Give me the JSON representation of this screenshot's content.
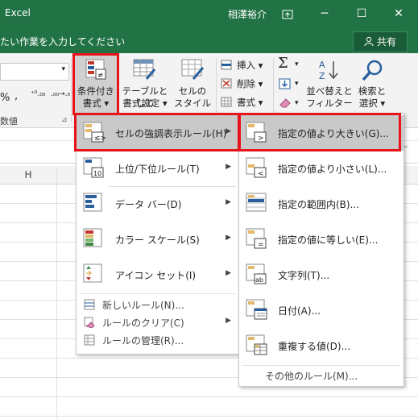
{
  "window": {
    "app_name": "Excel",
    "user_name": "相澤裕介",
    "minimize": "─",
    "maximize": "☐",
    "close": "✕",
    "restore_icon": "ribbon-display-icon"
  },
  "tellme": {
    "placeholder": "たい作業を入力してください",
    "share_label": "共有"
  },
  "ribbon": {
    "conditional_formatting": [
      "条件付き",
      "書式 ▾"
    ],
    "format_as_table": [
      "テーブルとして",
      "書式設定 ▾"
    ],
    "cell_styles": [
      "セルの",
      "スタイル ▾"
    ],
    "insert": "挿入 ▾",
    "delete": "削除 ▾",
    "format": "書式 ▾",
    "sum_arrow": "▾",
    "sort_filter": [
      "並べ替えと",
      "フィルター ▾"
    ],
    "find_select": [
      "検索と",
      "選択 ▾"
    ],
    "number_group_label": "数値",
    "percent": "%",
    "comma": ",",
    "inc_decimal": "⁺⁰.₀₀",
    "dec_decimal": ".₀₀→.₀",
    "number_format_dropdown": "▾"
  },
  "grid": {
    "column_h": "H"
  },
  "main_menu": {
    "items": [
      {
        "label": "セルの強調表示ルール(H)",
        "icon": "highlight-cells-icon",
        "arrow": "▶"
      },
      {
        "label": "上位/下位ルール(T)",
        "icon": "top-bottom-icon",
        "arrow": "▶"
      },
      {
        "label": "データ バー(D)",
        "icon": "data-bar-icon",
        "arrow": "▶"
      },
      {
        "label": "カラー スケール(S)",
        "icon": "color-scale-icon",
        "arrow": "▶"
      },
      {
        "label": "アイコン セット(I)",
        "icon": "icon-set-icon",
        "arrow": "▶"
      }
    ],
    "small_items": [
      {
        "label": "新しいルール(N)...",
        "icon": "new-rule-icon"
      },
      {
        "label": "ルールのクリア(C)",
        "icon": "clear-rules-icon",
        "arrow": "▶"
      },
      {
        "label": "ルールの管理(R)...",
        "icon": "manage-rules-icon"
      }
    ]
  },
  "sub_menu": {
    "items": [
      {
        "label": "指定の値より大きい(G)...",
        "icon": "greater-than-icon"
      },
      {
        "label": "指定の値より小さい(L)...",
        "icon": "less-than-icon"
      },
      {
        "label": "指定の範囲内(B)...",
        "icon": "between-icon"
      },
      {
        "label": "指定の値に等しい(E)...",
        "icon": "equal-to-icon"
      },
      {
        "label": "文字列(T)...",
        "icon": "text-contains-icon"
      },
      {
        "label": "日付(A)...",
        "icon": "date-occurring-icon"
      },
      {
        "label": "重複する値(D)...",
        "icon": "duplicate-values-icon"
      }
    ],
    "more_rules": "その他のルール(M)..."
  },
  "colors": {
    "excel_green": "#217346",
    "highlight_red": "#e8141b",
    "menu_hover": "#c9c9c9"
  }
}
